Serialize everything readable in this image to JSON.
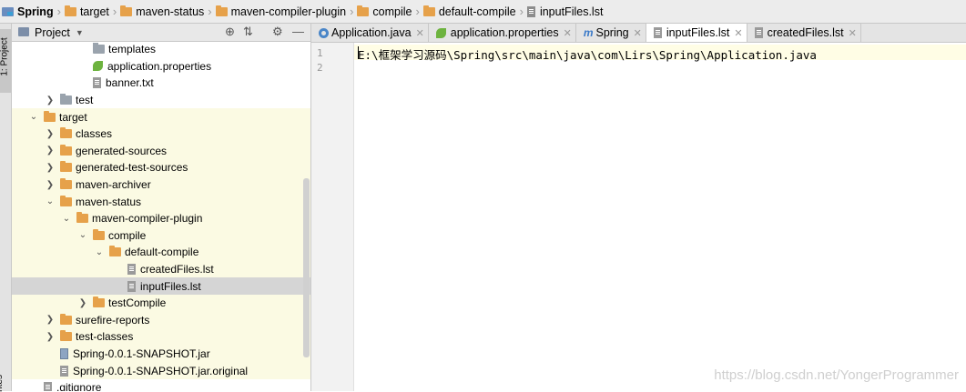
{
  "breadcrumb": [
    {
      "label": "Spring",
      "icon": "module-icon"
    },
    {
      "label": "target",
      "icon": "folder-icon"
    },
    {
      "label": "maven-status",
      "icon": "folder-icon"
    },
    {
      "label": "maven-compiler-plugin",
      "icon": "folder-icon"
    },
    {
      "label": "compile",
      "icon": "folder-icon"
    },
    {
      "label": "default-compile",
      "icon": "folder-icon"
    },
    {
      "label": "inputFiles.lst",
      "icon": "file-icon"
    }
  ],
  "side_stripe": {
    "project_label": "1: Project",
    "favorites_label": "ntes"
  },
  "project_panel": {
    "title": "Project"
  },
  "tree": [
    {
      "label": "templates"
    },
    {
      "label": "application.properties"
    },
    {
      "label": "banner.txt"
    },
    {
      "label": "test"
    },
    {
      "label": "target"
    },
    {
      "label": "classes"
    },
    {
      "label": "generated-sources"
    },
    {
      "label": "generated-test-sources"
    },
    {
      "label": "maven-archiver"
    },
    {
      "label": "maven-status"
    },
    {
      "label": "maven-compiler-plugin"
    },
    {
      "label": "compile"
    },
    {
      "label": "default-compile"
    },
    {
      "label": "createdFiles.lst"
    },
    {
      "label": "inputFiles.lst"
    },
    {
      "label": "testCompile"
    },
    {
      "label": "surefire-reports"
    },
    {
      "label": "test-classes"
    },
    {
      "label": "Spring-0.0.1-SNAPSHOT.jar"
    },
    {
      "label": "Spring-0.0.1-SNAPSHOT.jar.original"
    },
    {
      "label": ".gitignore"
    }
  ],
  "tabs": [
    {
      "label": "Application.java"
    },
    {
      "label": "application.properties"
    },
    {
      "label": "Spring"
    },
    {
      "label": "inputFiles.lst"
    },
    {
      "label": "createdFiles.lst"
    }
  ],
  "editor": {
    "line_numbers": [
      "1",
      "2"
    ],
    "code_line_1": "E:\\框架学习源码\\Spring\\src\\main\\java\\com\\Lirs\\Spring\\Application.java"
  },
  "watermark": "https://blog.csdn.net/YongerProgrammer"
}
